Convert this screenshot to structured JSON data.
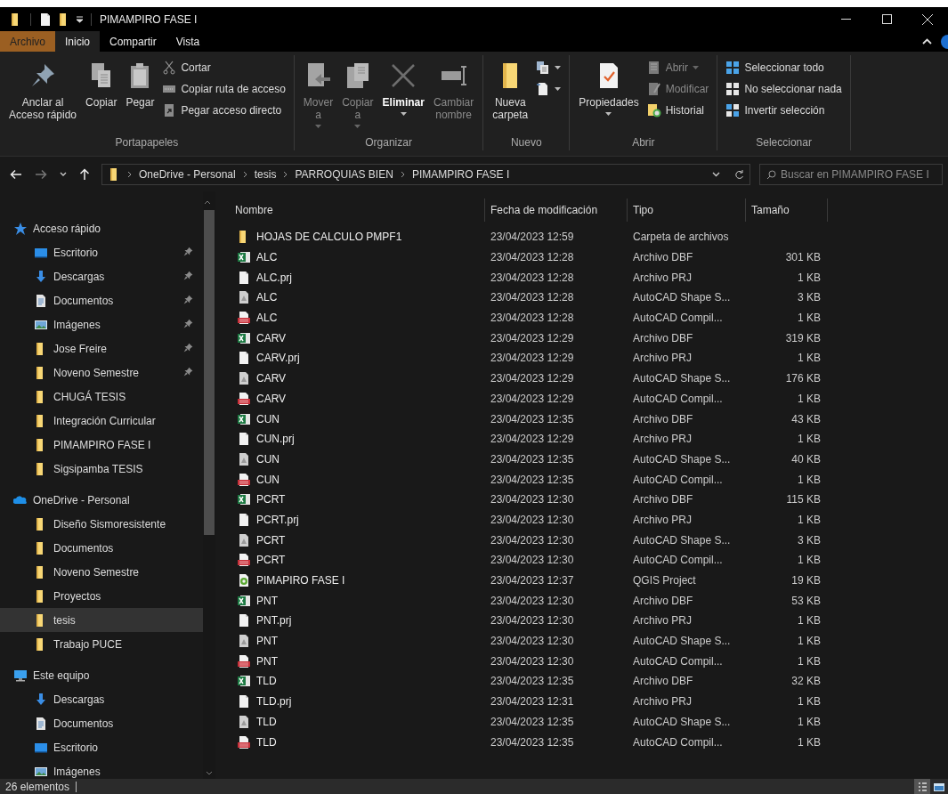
{
  "window": {
    "title": "PIMAMPIRO FASE I"
  },
  "ribbon_tabs": [
    {
      "label": "Archivo",
      "kind": "file",
      "selected": false
    },
    {
      "label": "Inicio",
      "kind": "tab",
      "selected": true
    },
    {
      "label": "Compartir",
      "kind": "tab",
      "selected": false
    },
    {
      "label": "Vista",
      "kind": "tab",
      "selected": false
    }
  ],
  "ribbon_groups": [
    {
      "label": "Portapapeles",
      "items": [
        {
          "kind": "large",
          "label": "Anclar al\nAcceso rápido",
          "disabled": false,
          "dropdown": false
        },
        {
          "kind": "large",
          "label": "Copiar",
          "disabled": false,
          "dropdown": false
        },
        {
          "kind": "large",
          "label": "Pegar",
          "disabled": false,
          "dropdown": false
        },
        {
          "kind": "stack",
          "items": [
            {
              "label": "Cortar",
              "disabled": false,
              "dropdown": false
            },
            {
              "label": "Copiar ruta de acceso",
              "disabled": false,
              "dropdown": false
            },
            {
              "label": "Pegar acceso directo",
              "disabled": false,
              "dropdown": false
            }
          ]
        }
      ]
    },
    {
      "label": "Organizar",
      "items": [
        {
          "kind": "large",
          "label": "Mover\na",
          "disabled": true,
          "dropdown": true
        },
        {
          "kind": "large",
          "label": "Copiar\na",
          "disabled": true,
          "dropdown": true
        },
        {
          "kind": "large",
          "label": "Eliminar",
          "disabled": false,
          "dropdown": true
        },
        {
          "kind": "large",
          "label": "Cambiar\nnombre",
          "disabled": true,
          "dropdown": false
        }
      ]
    },
    {
      "label": "Nuevo",
      "items": [
        {
          "kind": "large",
          "label": "Nueva\ncarpeta",
          "disabled": false,
          "dropdown": false
        },
        {
          "kind": "stack",
          "items": [
            {
              "disabled": false,
              "dropdown": true
            },
            {
              "disabled": false,
              "dropdown": true
            }
          ]
        }
      ]
    },
    {
      "label": "Abrir",
      "items": [
        {
          "kind": "large",
          "label": "Propiedades",
          "disabled": false,
          "dropdown": true
        },
        {
          "kind": "stack",
          "items": [
            {
              "label": "Abrir",
              "disabled": true,
              "dropdown": true
            },
            {
              "label": "Modificar",
              "disabled": true,
              "dropdown": false
            },
            {
              "label": "Historial",
              "disabled": false,
              "dropdown": false
            }
          ]
        }
      ]
    },
    {
      "label": "Seleccionar",
      "items": [
        {
          "kind": "stack",
          "items": [
            {
              "label": "Seleccionar todo",
              "disabled": false,
              "dropdown": false
            },
            {
              "label": "No seleccionar nada",
              "disabled": false,
              "dropdown": false
            },
            {
              "label": "Invertir selección",
              "disabled": false,
              "dropdown": false
            }
          ]
        }
      ]
    }
  ],
  "address": {
    "path": [
      "OneDrive - Personal",
      "tesis",
      "PARROQUIAS BIEN",
      "PIMAMPIRO FASE I"
    ],
    "search_placeholder": "Buscar en PIMAMPIRO FASE I"
  },
  "sidebar": [
    {
      "label": "Acceso rápido",
      "kind": "star",
      "items": [
        {
          "label": "Escritorio",
          "kind": "desktop",
          "pinned": true,
          "selected": false
        },
        {
          "label": "Descargas",
          "kind": "download",
          "pinned": true,
          "selected": false
        },
        {
          "label": "Documentos",
          "kind": "docs",
          "pinned": true,
          "selected": false
        },
        {
          "label": "Imágenes",
          "kind": "images",
          "pinned": true,
          "selected": false
        },
        {
          "label": "Jose Freire",
          "kind": "folder",
          "pinned": true,
          "selected": false
        },
        {
          "label": "Noveno Semestre",
          "kind": "folder",
          "pinned": true,
          "selected": false
        },
        {
          "label": "CHUGÁ TESIS",
          "kind": "folder",
          "pinned": false,
          "selected": false
        },
        {
          "label": "Integración Curricular",
          "kind": "folder",
          "pinned": false,
          "selected": false
        },
        {
          "label": "PIMAMPIRO FASE I",
          "kind": "folder",
          "pinned": false,
          "selected": false
        },
        {
          "label": "Sigsipamba TESIS",
          "kind": "folder",
          "pinned": false,
          "selected": false
        }
      ]
    },
    {
      "label": "OneDrive - Personal",
      "kind": "cloud",
      "items": [
        {
          "label": "Diseño Sismoresistente",
          "kind": "folder",
          "pinned": false,
          "selected": false
        },
        {
          "label": "Documentos",
          "kind": "folder",
          "pinned": false,
          "selected": false
        },
        {
          "label": "Noveno Semestre",
          "kind": "folder",
          "pinned": false,
          "selected": false
        },
        {
          "label": "Proyectos",
          "kind": "folder",
          "pinned": false,
          "selected": false
        },
        {
          "label": "tesis",
          "kind": "folder",
          "pinned": false,
          "selected": true
        },
        {
          "label": "Trabajo PUCE",
          "kind": "folder",
          "pinned": false,
          "selected": false
        }
      ]
    },
    {
      "label": "Este equipo",
      "kind": "pc",
      "items": [
        {
          "label": "Descargas",
          "kind": "download",
          "pinned": false,
          "selected": false
        },
        {
          "label": "Documentos",
          "kind": "docs",
          "pinned": false,
          "selected": false
        },
        {
          "label": "Escritorio",
          "kind": "desktop",
          "pinned": false,
          "selected": false
        },
        {
          "label": "Imágenes",
          "kind": "images",
          "pinned": false,
          "selected": false
        }
      ]
    }
  ],
  "columns": [
    "Nombre",
    "Fecha de modificación",
    "Tipo",
    "Tamaño"
  ],
  "files": [
    {
      "name": "HOJAS DE CALCULO PMPF1",
      "kind": "folder",
      "modified": "23/04/2023 12:59",
      "type": "Carpeta de archivos"
    },
    {
      "name": "ALC",
      "kind": "excel",
      "modified": "23/04/2023 12:28",
      "type": "Archivo DBF",
      "size": "301 KB"
    },
    {
      "name": "ALC.prj",
      "kind": "blank",
      "modified": "23/04/2023 12:28",
      "type": "Archivo PRJ",
      "size": "1 KB"
    },
    {
      "name": "ALC",
      "kind": "shape",
      "modified": "23/04/2023 12:28",
      "type": "AutoCAD Shape S...",
      "size": "3 KB"
    },
    {
      "name": "ALC",
      "kind": "shx",
      "modified": "23/04/2023 12:28",
      "type": "AutoCAD Compil...",
      "size": "1 KB"
    },
    {
      "name": "CARV",
      "kind": "excel",
      "modified": "23/04/2023 12:29",
      "type": "Archivo DBF",
      "size": "319 KB"
    },
    {
      "name": "CARV.prj",
      "kind": "blank",
      "modified": "23/04/2023 12:29",
      "type": "Archivo PRJ",
      "size": "1 KB"
    },
    {
      "name": "CARV",
      "kind": "shape",
      "modified": "23/04/2023 12:29",
      "type": "AutoCAD Shape S...",
      "size": "176 KB"
    },
    {
      "name": "CARV",
      "kind": "shx",
      "modified": "23/04/2023 12:29",
      "type": "AutoCAD Compil...",
      "size": "1 KB"
    },
    {
      "name": "CUN",
      "kind": "excel",
      "modified": "23/04/2023 12:35",
      "type": "Archivo DBF",
      "size": "43 KB"
    },
    {
      "name": "CUN.prj",
      "kind": "blank",
      "modified": "23/04/2023 12:29",
      "type": "Archivo PRJ",
      "size": "1 KB"
    },
    {
      "name": "CUN",
      "kind": "shape",
      "modified": "23/04/2023 12:35",
      "type": "AutoCAD Shape S...",
      "size": "40 KB"
    },
    {
      "name": "CUN",
      "kind": "shx",
      "modified": "23/04/2023 12:35",
      "type": "AutoCAD Compil...",
      "size": "1 KB"
    },
    {
      "name": "PCRT",
      "kind": "excel",
      "modified": "23/04/2023 12:30",
      "type": "Archivo DBF",
      "size": "115 KB"
    },
    {
      "name": "PCRT.prj",
      "kind": "blank",
      "modified": "23/04/2023 12:30",
      "type": "Archivo PRJ",
      "size": "1 KB"
    },
    {
      "name": "PCRT",
      "kind": "shape",
      "modified": "23/04/2023 12:30",
      "type": "AutoCAD Shape S...",
      "size": "3 KB"
    },
    {
      "name": "PCRT",
      "kind": "shx",
      "modified": "23/04/2023 12:30",
      "type": "AutoCAD Compil...",
      "size": "1 KB"
    },
    {
      "name": "PIMAPIRO FASE I",
      "kind": "qgis",
      "modified": "23/04/2023 12:37",
      "type": "QGIS Project",
      "size": "19 KB"
    },
    {
      "name": "PNT",
      "kind": "excel",
      "modified": "23/04/2023 12:30",
      "type": "Archivo DBF",
      "size": "53 KB"
    },
    {
      "name": "PNT.prj",
      "kind": "blank",
      "modified": "23/04/2023 12:30",
      "type": "Archivo PRJ",
      "size": "1 KB"
    },
    {
      "name": "PNT",
      "kind": "shape",
      "modified": "23/04/2023 12:30",
      "type": "AutoCAD Shape S...",
      "size": "1 KB"
    },
    {
      "name": "PNT",
      "kind": "shx",
      "modified": "23/04/2023 12:30",
      "type": "AutoCAD Compil...",
      "size": "1 KB"
    },
    {
      "name": "TLD",
      "kind": "excel",
      "modified": "23/04/2023 12:35",
      "type": "Archivo DBF",
      "size": "32 KB"
    },
    {
      "name": "TLD.prj",
      "kind": "blank",
      "modified": "23/04/2023 12:31",
      "type": "Archivo PRJ",
      "size": "1 KB"
    },
    {
      "name": "TLD",
      "kind": "shape",
      "modified": "23/04/2023 12:35",
      "type": "AutoCAD Shape S...",
      "size": "1 KB"
    },
    {
      "name": "TLD",
      "kind": "shx",
      "modified": "23/04/2023 12:35",
      "type": "AutoCAD Compil...",
      "size": "1 KB"
    }
  ],
  "status_bar": {
    "count": "26 elementos"
  }
}
